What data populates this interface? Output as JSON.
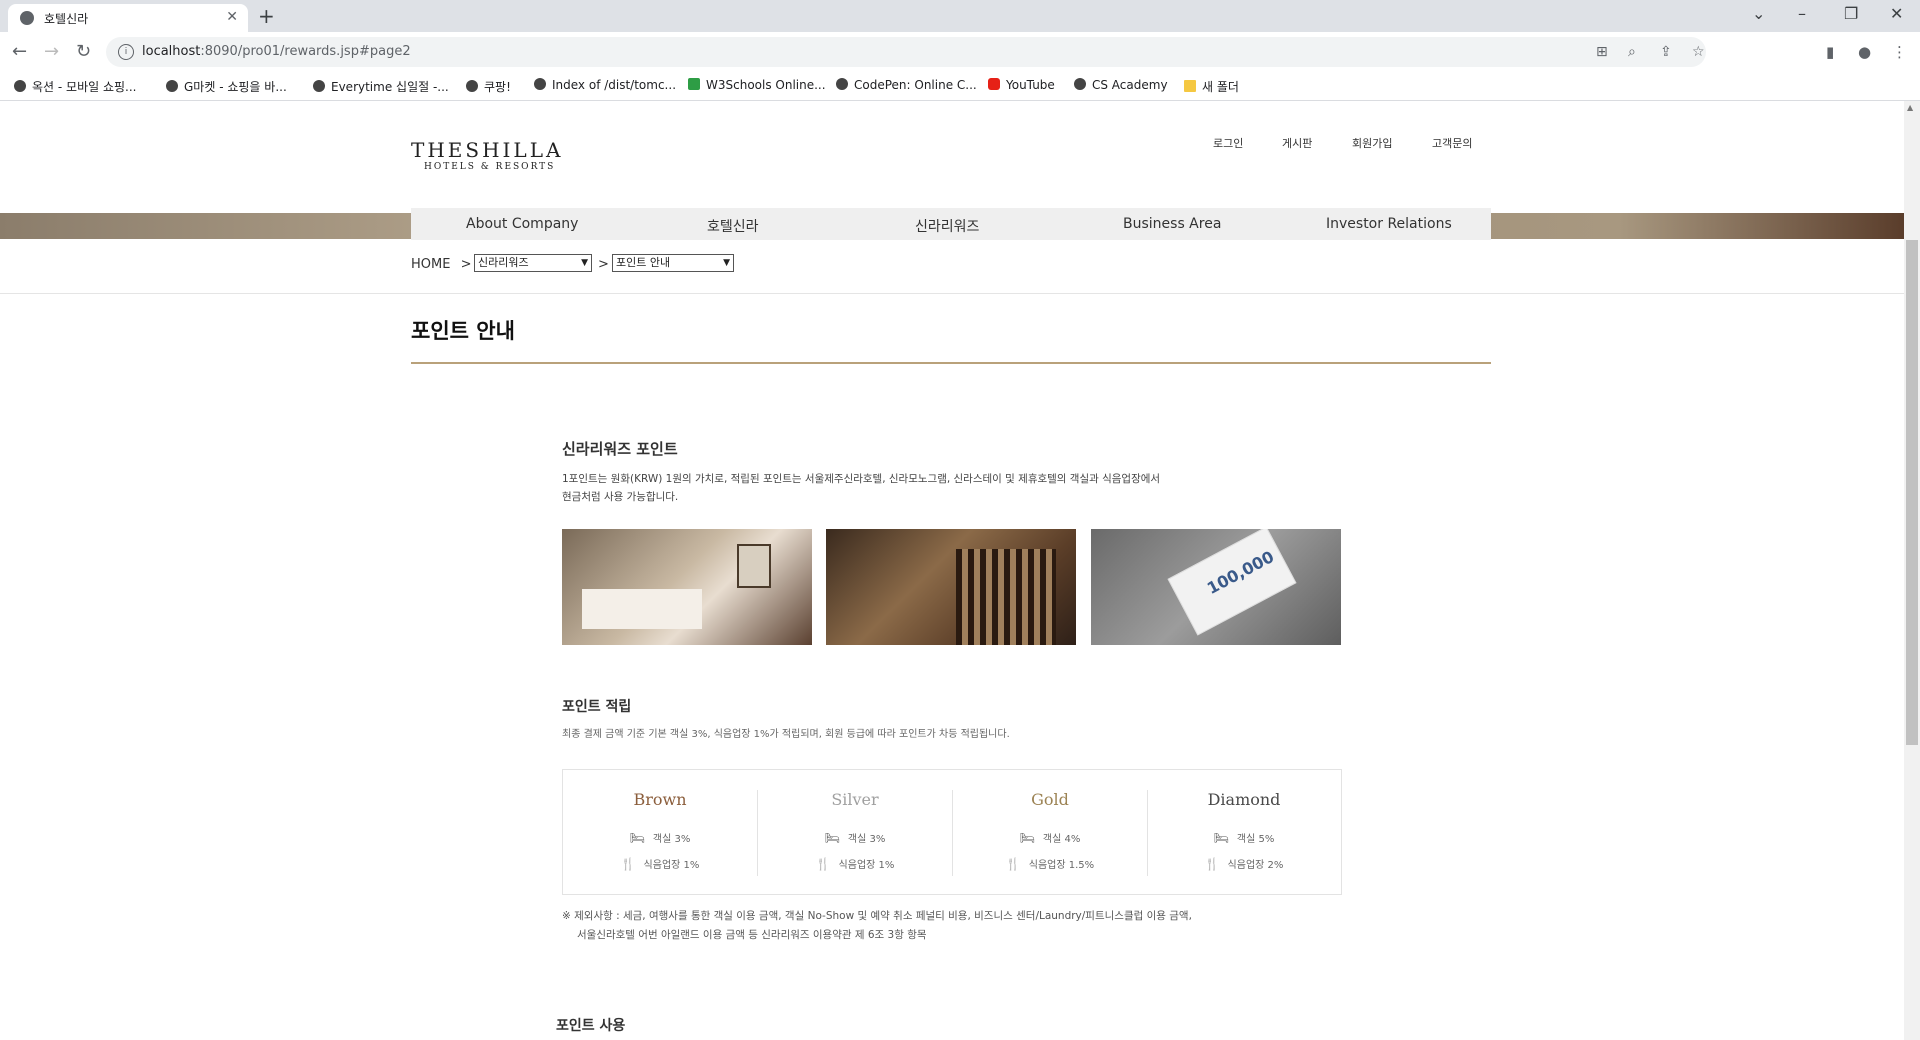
{
  "browser": {
    "tab_title": "호텔신라",
    "new_tab": "+",
    "url_host": "localhost",
    "url_rest": ":8090/pro01/rewards.jsp#page2",
    "bookmarks": [
      {
        "label": "옥션 - 모바일 쇼핑...",
        "icon": "globe-icon"
      },
      {
        "label": "G마켓 - 쇼핑을 바...",
        "icon": "globe-icon"
      },
      {
        "label": "Everytime 십일절 -...",
        "icon": "globe-icon"
      },
      {
        "label": "쿠팡!",
        "icon": "globe-icon"
      },
      {
        "label": "Index of /dist/tomc...",
        "icon": "globe-icon"
      },
      {
        "label": "W3Schools Online...",
        "icon": "w3schools-icon"
      },
      {
        "label": "CodePen: Online C...",
        "icon": "codepen-icon"
      },
      {
        "label": "YouTube",
        "icon": "youtube-icon"
      },
      {
        "label": "CS Academy",
        "icon": "csacademy-icon"
      },
      {
        "label": "새 폴더",
        "icon": "folder-icon"
      }
    ]
  },
  "header": {
    "logo_line1": "THESHILLA",
    "logo_line2": "HOTELS & RESORTS",
    "util_links": [
      "로그인",
      "게시판",
      "회원가입",
      "고객문의"
    ]
  },
  "gnb": [
    "About Company",
    "호텔신라",
    "신라리워즈",
    "Business Area",
    "Investor Relations"
  ],
  "breadcrumb": {
    "home": "HOME",
    "sep": ">",
    "select1": "신라리워즈",
    "select2": "포인트 안내"
  },
  "page_title": "포인트 안내",
  "section1": {
    "title": "신라리워즈 포인트",
    "line1": "1포인트는 원화(KRW) 1원의 가치로, 적립된 포인트는 서울제주신라호텔, 신라모노그램, 신라스테이 및 제휴호텔의 객실과 식음업장에서",
    "line2": "현금처럼 사용 가능합니다.",
    "ticket_text": "100,000"
  },
  "section2": {
    "title": "포인트 적립",
    "desc": "최종 결제 금액 기준 기본 객실 3%, 식음업장 1%가 적립되며, 회원 등급에 따라 포인트가 차등 적립됩니다.",
    "tiers": [
      {
        "name": "Brown",
        "room": "객실 3%",
        "dining": "식음업장 1%",
        "color": "#8b5e3c"
      },
      {
        "name": "Silver",
        "room": "객실 3%",
        "dining": "식음업장 1%",
        "color": "#a0a0a0"
      },
      {
        "name": "Gold",
        "room": "객실 4%",
        "dining": "식음업장 1.5%",
        "color": "#9c8354"
      },
      {
        "name": "Diamond",
        "room": "객실 5%",
        "dining": "식음업장 2%",
        "color": "#4a4a4a"
      }
    ],
    "note1": "※ 제외사항 : 세금, 여행사를 통한 객실 이용 금액, 객실 No-Show 및 예약 취소 페널티 비용, 비즈니스 센터/Laundry/피트니스클럽 이용 금액,",
    "note2": "서울신라호텔 어번 아일랜드 이용 금액 등 신라리워즈 이용약관 제 6조 3항 항목"
  },
  "section3": {
    "title": "포인트 사용"
  },
  "colors": {
    "accent_rule": "#b9a17a",
    "gnb_bg": "#efefef"
  }
}
